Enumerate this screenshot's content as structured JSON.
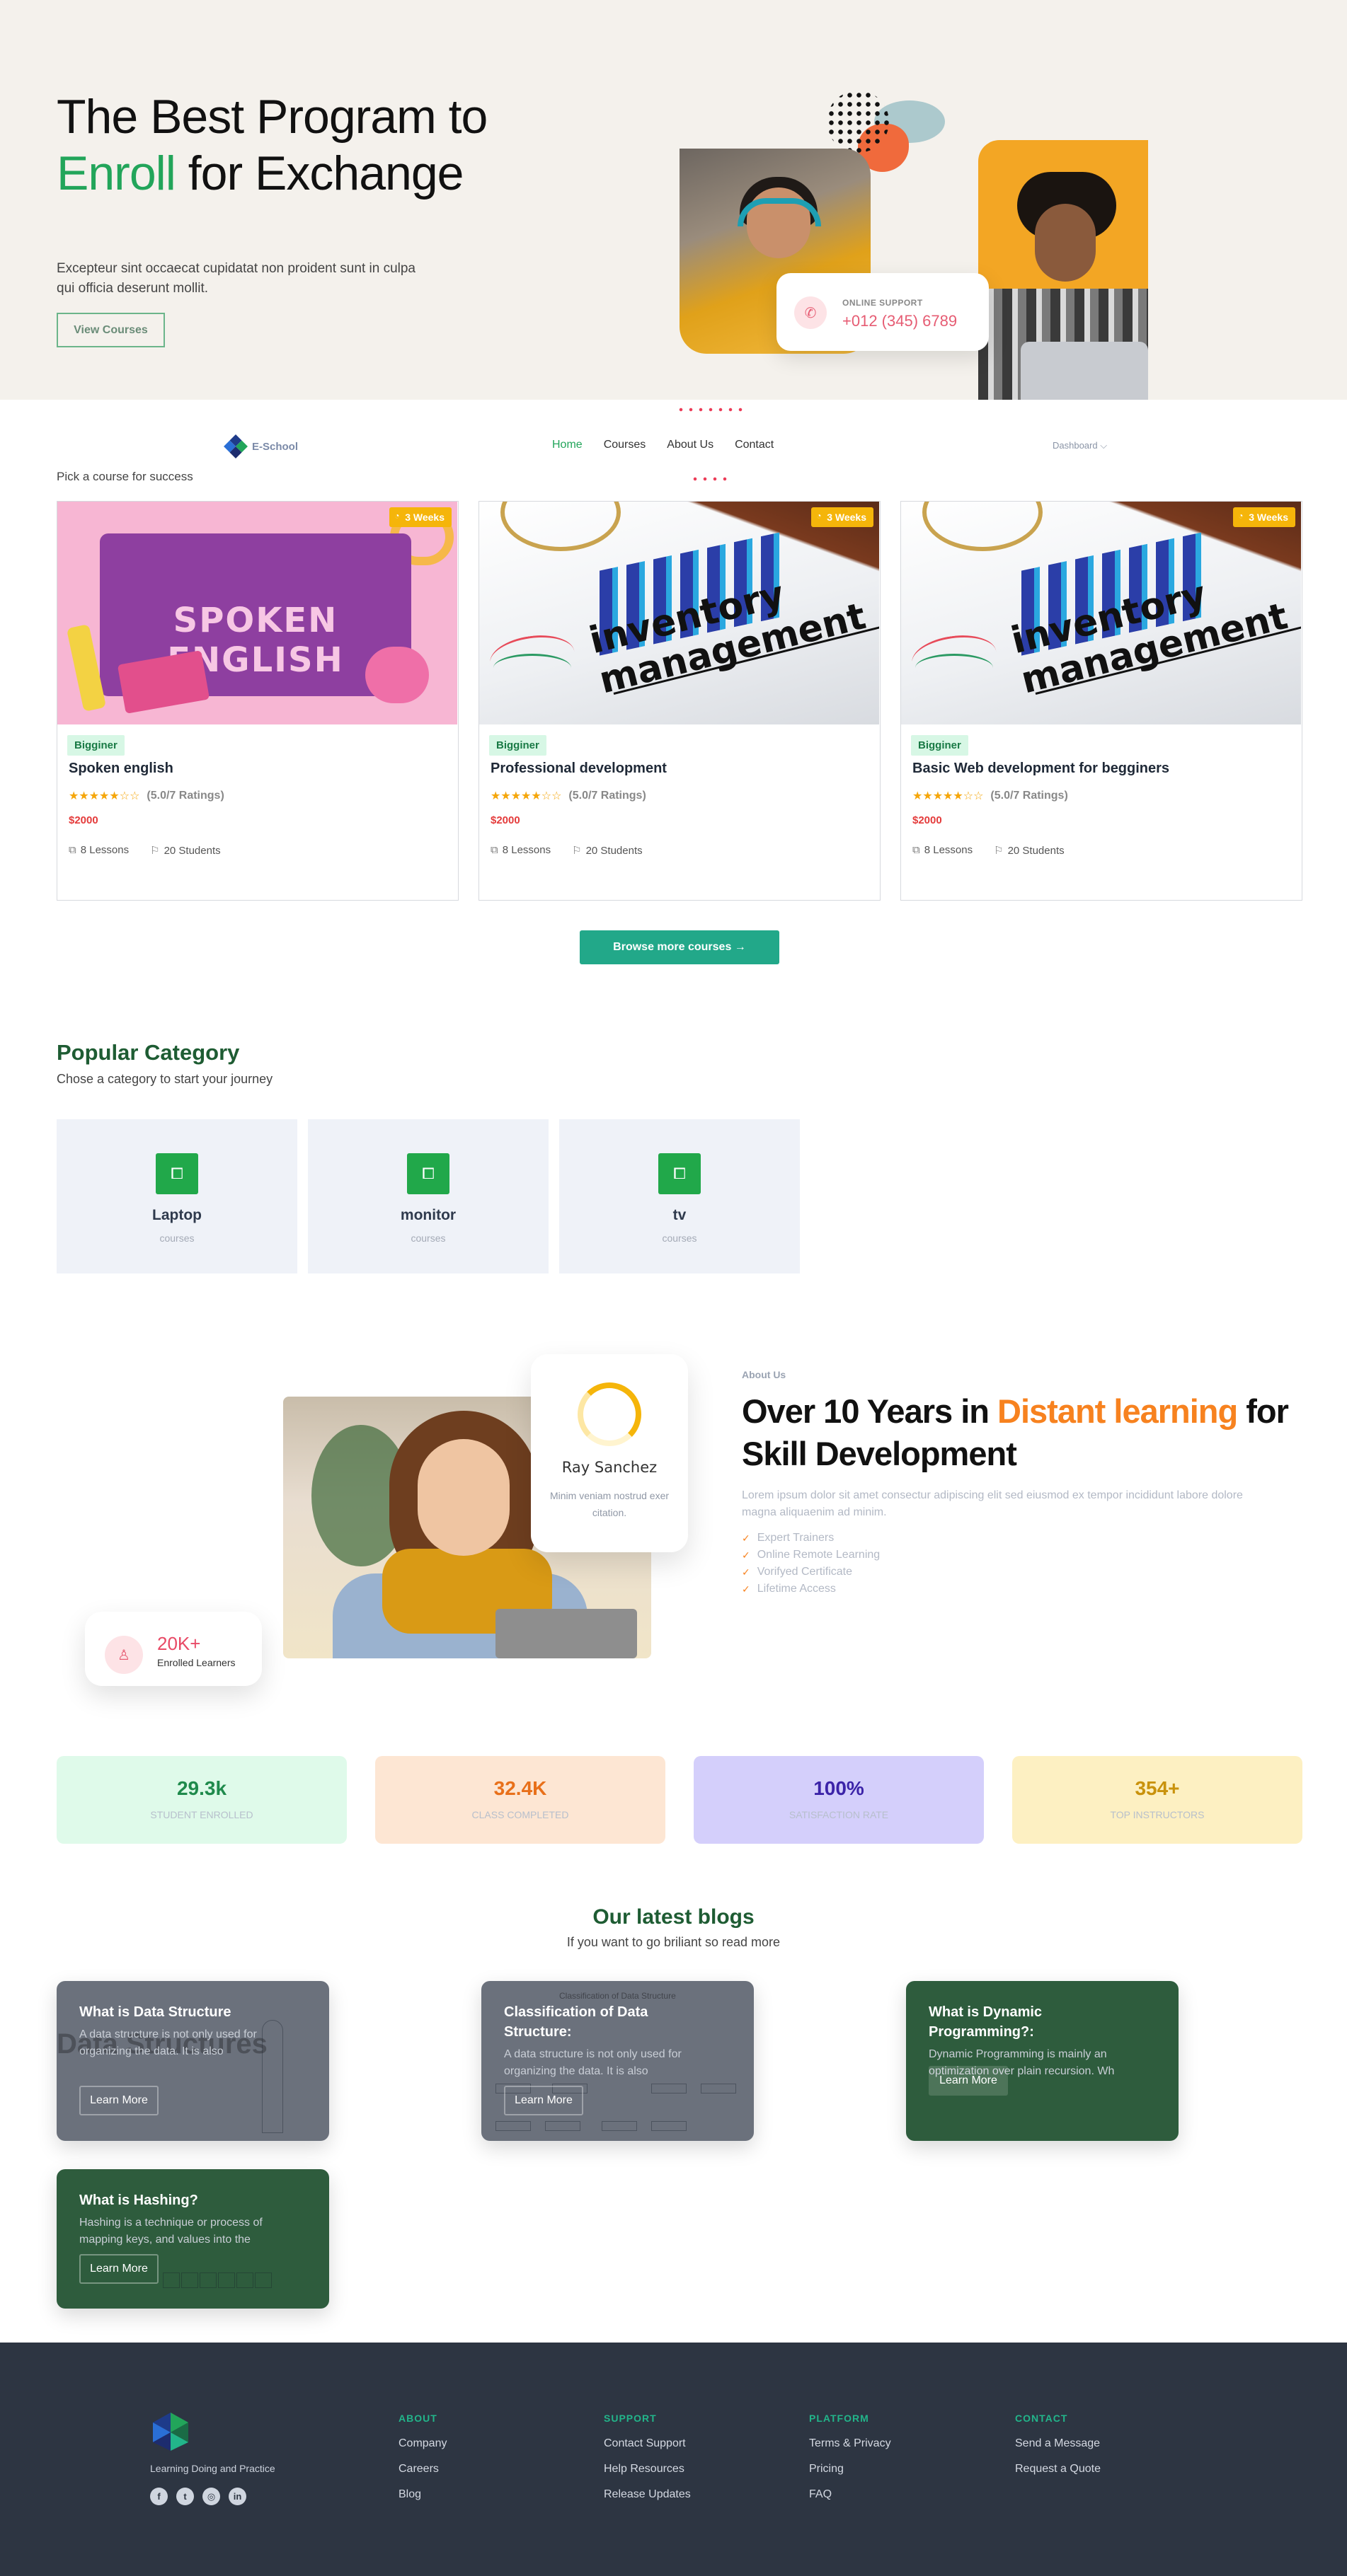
{
  "hero": {
    "title_part1": "The Best Program to",
    "title_accent": "Enroll",
    "title_part2": "for Exchange",
    "subtitle": "Excepteur sint occaecat cupidatat non proident sunt in culpa qui officia deserunt mollit.",
    "cta_label": "View Courses",
    "support": {
      "label": "ONLINE SUPPORT",
      "phone": "+012 (345) 6789"
    }
  },
  "nav": {
    "brand": "E-School",
    "links": [
      "Home",
      "Courses",
      "About Us",
      "Contact"
    ],
    "active": "Home",
    "dashboard": "Dashboard"
  },
  "courses": {
    "intro": "Pick a course for success",
    "items": [
      {
        "title": "Spoken english",
        "duration": "3 Weeks",
        "level": "Bigginer",
        "rating_text": "(5.0/7 Ratings)",
        "stars_filled": 5,
        "price": "$2000",
        "lessons": "8 Lessons",
        "students": "20 Students",
        "image_text": "SPOKEN ENGLISH"
      },
      {
        "title": "Professional development",
        "duration": "3 Weeks",
        "level": "Bigginer",
        "rating_text": "(5.0/7 Ratings)",
        "stars_filled": 5,
        "price": "$2000",
        "lessons": "8 Lessons",
        "students": "20 Students",
        "image_text_1": "inventory",
        "image_text_2": "management"
      },
      {
        "title": "Basic Web development for begginers",
        "duration": "3 Weeks",
        "level": "Bigginer",
        "rating_text": "(5.0/7 Ratings)",
        "stars_filled": 5,
        "price": "$2000",
        "lessons": "8 Lessons",
        "students": "20 Students",
        "image_text_1": "inventory",
        "image_text_2": "management"
      }
    ],
    "browse_label": "Browse more courses"
  },
  "categories": {
    "title": "Popular Category",
    "subtitle": "Chose a category to start your journey",
    "items": [
      {
        "name": "Laptop",
        "count": "courses"
      },
      {
        "name": "monitor",
        "count": "courses"
      },
      {
        "name": "tv",
        "count": "courses"
      }
    ]
  },
  "about": {
    "tag": "About Us",
    "title_part1": "Over 10 Years in",
    "title_accent": "Distant learning",
    "title_part2": "for Skill Development",
    "text": "Lorem ipsum dolor sit amet consectur adipiscing elit sed eiusmod ex tempor incididunt labore dolore magna aliquaenim ad minim.",
    "list": [
      "Expert Trainers",
      "Online Remote Learning",
      "Vorifyed Certificate",
      "Lifetime Access"
    ],
    "quote": {
      "name": "Ray Sanchez",
      "text": "Minim veniam nostrud exer citation."
    },
    "learners": {
      "count": "20K+",
      "label": "Enrolled Learners"
    }
  },
  "stats": [
    {
      "value": "29.3k",
      "label": "STUDENT ENROLLED",
      "bg": "#dffaea",
      "color": "#1f8a4c"
    },
    {
      "value": "32.4K",
      "label": "CLASS COMPLETED",
      "bg": "#fde6d3",
      "color": "#e8701a"
    },
    {
      "value": "100%",
      "label": "SATISFACTION RATE",
      "bg": "#d4cffb",
      "color": "#3b23a8"
    },
    {
      "value": "354+",
      "label": "TOP INSTRUCTORS",
      "bg": "#fdf0c2",
      "color": "#c9920c"
    }
  ],
  "blogs": {
    "title": "Our latest blogs",
    "subtitle": "If you want to go briliant so read more",
    "items": [
      {
        "title": "What is Data Structure",
        "text": "A data structure is not only used for organizing the data. It is also",
        "button": "Learn More",
        "bg_text": "Data Structures"
      },
      {
        "title": "Classification of Data Structure:",
        "text": "A data structure is not only used for organizing the data. It is also",
        "button": "Learn More",
        "bg_text": "Classification of Data Structure"
      },
      {
        "title": "What is Dynamic Programming?:",
        "text": "Dynamic Programming is mainly an optimization over plain recursion. Wh",
        "button": "Learn More"
      },
      {
        "title": "What is Hashing?",
        "text": "Hashing is a technique or process of mapping keys, and values into the",
        "button": "Learn More"
      }
    ]
  },
  "footer": {
    "tagline": "Learning Doing and Practice",
    "columns": [
      {
        "heading": "ABOUT",
        "links": [
          "Company",
          "Careers",
          "Blog"
        ]
      },
      {
        "heading": "SUPPORT",
        "links": [
          "Contact Support",
          "Help Resources",
          "Release Updates"
        ]
      },
      {
        "heading": "PLATFORM",
        "links": [
          "Terms & Privacy",
          "Pricing",
          "FAQ"
        ]
      },
      {
        "heading": "CONTACT",
        "links": [
          "Send a Message",
          "Request a Quote"
        ]
      }
    ],
    "social_icons": [
      "facebook-icon",
      "twitter-icon",
      "instagram-icon",
      "linkedin-icon"
    ]
  }
}
